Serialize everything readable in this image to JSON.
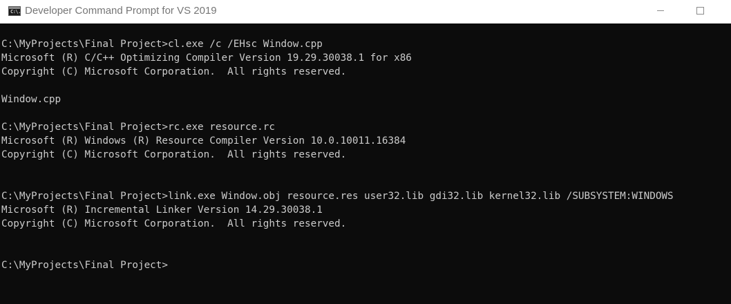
{
  "window": {
    "title": "Developer Command Prompt for VS 2019",
    "icon": "command-prompt-icon",
    "icon_text": "C:\\.",
    "controls": {
      "minimize": "minimize-icon",
      "maximize": "maximize-icon"
    }
  },
  "console": {
    "background": "#0c0c0c",
    "foreground": "#cccccc",
    "lines": [
      "C:\\MyProjects\\Final Project>cl.exe /c /EHsc Window.cpp",
      "Microsoft (R) C/C++ Optimizing Compiler Version 19.29.30038.1 for x86",
      "Copyright (C) Microsoft Corporation.  All rights reserved.",
      "",
      "Window.cpp",
      "",
      "C:\\MyProjects\\Final Project>rc.exe resource.rc",
      "Microsoft (R) Windows (R) Resource Compiler Version 10.0.10011.16384",
      "Copyright (C) Microsoft Corporation.  All rights reserved.",
      "",
      "",
      "C:\\MyProjects\\Final Project>link.exe Window.obj resource.res user32.lib gdi32.lib kernel32.lib /SUBSYSTEM:WINDOWS",
      "Microsoft (R) Incremental Linker Version 14.29.30038.1",
      "Copyright (C) Microsoft Corporation.  All rights reserved.",
      "",
      "",
      "C:\\MyProjects\\Final Project>"
    ]
  }
}
